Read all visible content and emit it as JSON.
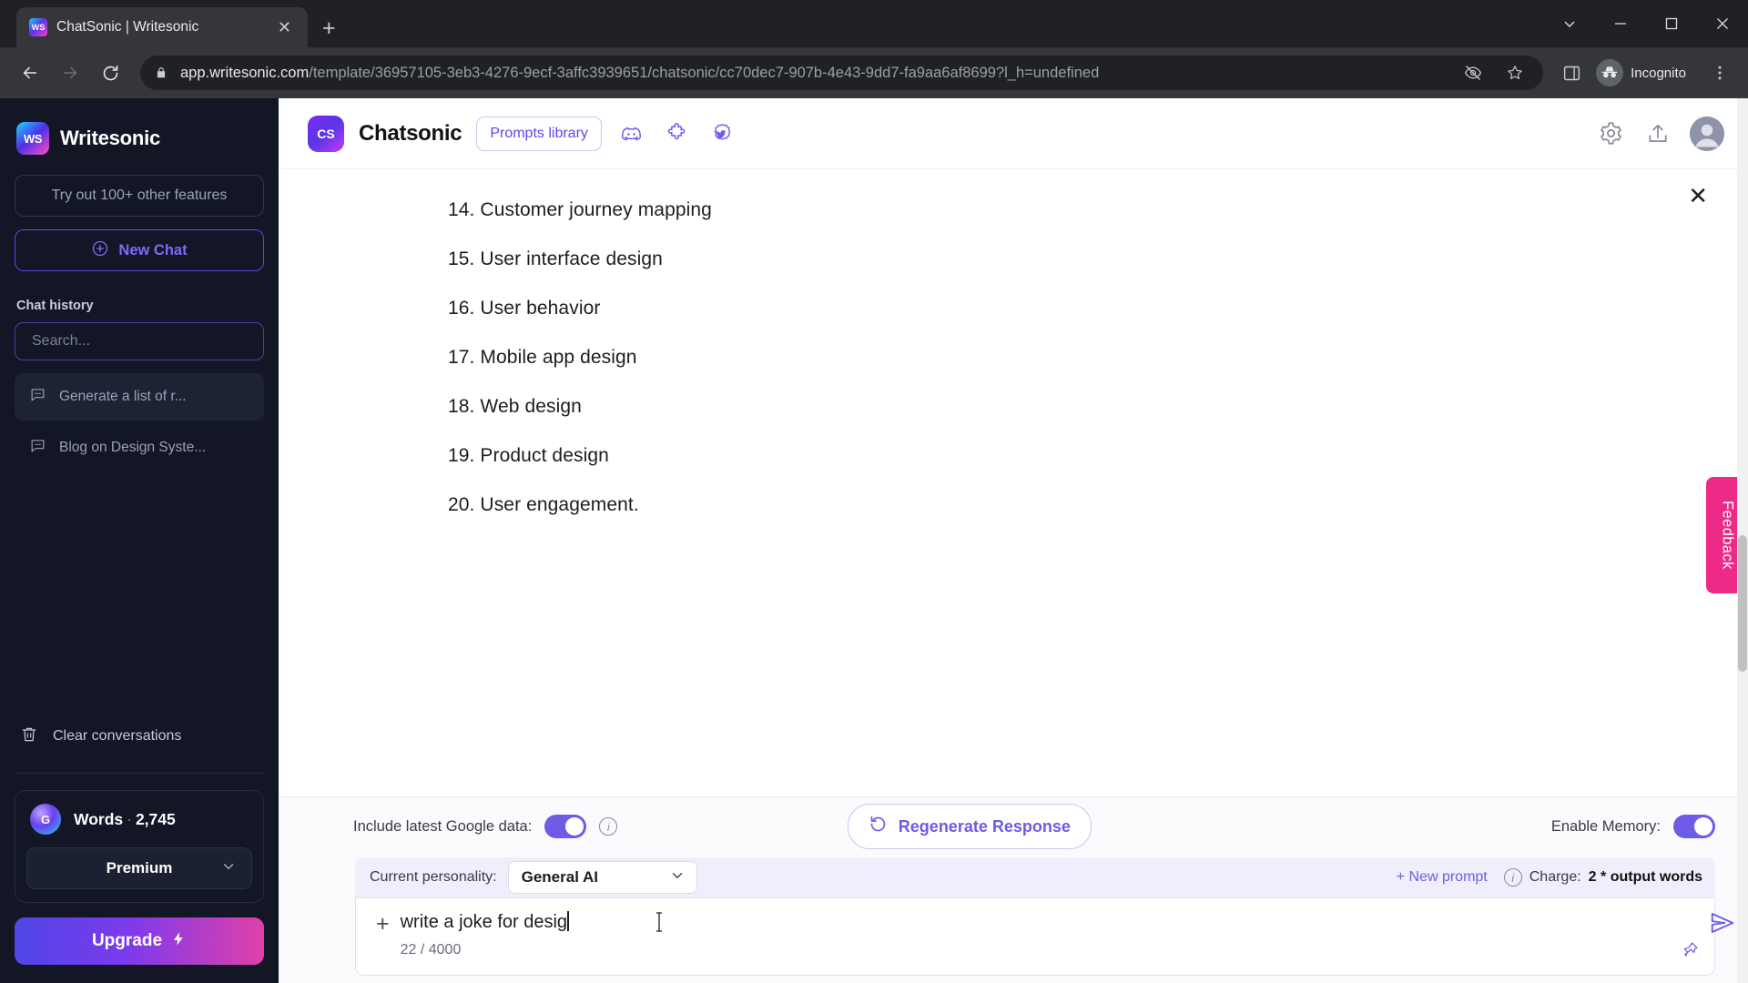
{
  "browser": {
    "tab": {
      "title": "ChatSonic | Writesonic",
      "favicon_label": "WS",
      "close_icon": "close-icon"
    },
    "new_tab_label": "+",
    "url_host": "app.writesonic.com",
    "url_path": "/template/36957105-3eb3-4276-9ecf-3affc3939651/chatsonic/cc70dec7-907b-4e43-9dd7-fa9aa6af8699?l_h=undefined",
    "profile_label": "Incognito",
    "window_controls": {
      "minimize": "minimize-icon",
      "maximize": "maximize-icon",
      "close": "close-icon"
    }
  },
  "sidebar": {
    "brand": {
      "name": "Writesonic",
      "logo_label": "WS"
    },
    "try_features_label": "Try out 100+ other features",
    "new_chat_label": "New Chat",
    "chat_history_label": "Chat history",
    "search_placeholder": "Search...",
    "history": [
      {
        "label": "Generate a list of r...",
        "active": true
      },
      {
        "label": "Blog on Design Syste...",
        "active": false
      }
    ],
    "clear_conversations_label": "Clear conversations",
    "plan": {
      "words_label": "Words",
      "separator": "·",
      "words_count": "2,745",
      "premium_label": "Premium",
      "upgrade_label": "Upgrade"
    }
  },
  "chat_header": {
    "logo_label": "CS",
    "title": "Chatsonic",
    "prompts_library_label": "Prompts library",
    "icons": [
      "discord-icon",
      "puzzle-extension-icon",
      "twitter-badge-icon"
    ],
    "right_icons": [
      "gear-icon",
      "share-icon",
      "avatar"
    ]
  },
  "conversation": {
    "close_label": "✕",
    "lines": [
      "14. Customer journey mapping",
      "15. User interface design",
      "16. User behavior",
      "17. Mobile app design",
      "18. Web design",
      "19. Product design",
      "20. User engagement."
    ]
  },
  "feedback": {
    "label": "Feedback",
    "color": "#ed2a87"
  },
  "composer": {
    "google_data_label": "Include latest Google data:",
    "google_data_on": true,
    "regenerate_label": "Regenerate Response",
    "memory_label": "Enable Memory:",
    "memory_on": true,
    "personality_label": "Current personality:",
    "personality_value": "General AI",
    "new_prompt_label": "+ New prompt",
    "charge_label": "Charge:",
    "charge_value": "2 * output words",
    "input_value": "write a joke for desig",
    "counter": "22 / 4000",
    "plus_label": "+"
  },
  "colors": {
    "accent": "#6c5ce7",
    "sidebar_bg": "#121625",
    "feedback_pink": "#ed2a87",
    "browser_chrome": "#35363a"
  }
}
